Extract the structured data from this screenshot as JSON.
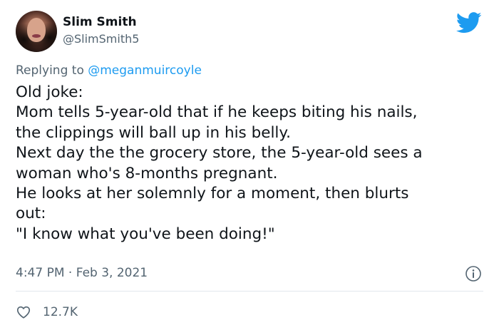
{
  "author": {
    "display_name": "Slim Smith",
    "handle": "@SlimSmith5"
  },
  "reply": {
    "prefix": "Replying to ",
    "mention": "@meganmuircoyle"
  },
  "tweet_lines": [
    "Old joke:",
    "Mom tells 5-year-old that if he keeps biting his nails,",
    "the clippings will ball up in his belly.",
    "Next day the the grocery store, the 5-year-old sees a",
    "woman who's 8-months pregnant.",
    "He looks at her solemnly for a moment, then blurts",
    "out:",
    "\"I know what you've been doing!\""
  ],
  "meta": {
    "time": "4:47 PM",
    "separator": " · ",
    "date": "Feb 3, 2021"
  },
  "engagement": {
    "likes": "12.7K"
  },
  "icons": {
    "brand": "twitter-bird-icon",
    "info": "info-icon",
    "like": "heart-icon"
  },
  "colors": {
    "brand_blue": "#1d9bf0",
    "text_primary": "#0f1419",
    "text_secondary": "#536471",
    "divider": "#e1e8ed"
  }
}
